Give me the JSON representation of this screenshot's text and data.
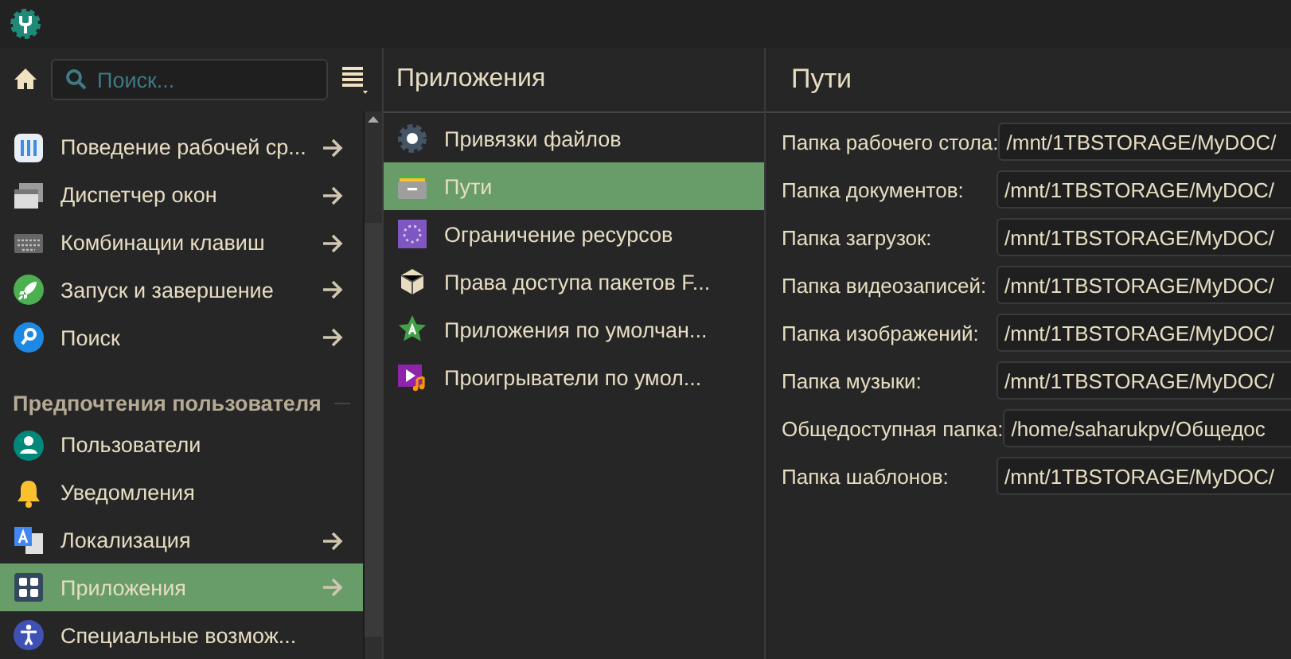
{
  "search": {
    "placeholder": "Поиск..."
  },
  "sidebar": {
    "groups": [
      {
        "items": [
          {
            "label": "Поведение рабочей ср...",
            "has_submenu": true,
            "selected": false
          },
          {
            "label": "Диспетчер окон",
            "has_submenu": true,
            "selected": false
          },
          {
            "label": "Комбинации клавиш",
            "has_submenu": true,
            "selected": false
          },
          {
            "label": "Запуск и завершение",
            "has_submenu": true,
            "selected": false
          },
          {
            "label": "Поиск",
            "has_submenu": true,
            "selected": false
          }
        ]
      },
      {
        "title": "Предпочтения пользователя",
        "items": [
          {
            "label": "Пользователи",
            "has_submenu": false,
            "selected": false
          },
          {
            "label": "Уведомления",
            "has_submenu": false,
            "selected": false
          },
          {
            "label": "Локализация",
            "has_submenu": true,
            "selected": false
          },
          {
            "label": "Приложения",
            "has_submenu": true,
            "selected": true
          },
          {
            "label": "Специальные возмож...",
            "has_submenu": false,
            "selected": false
          }
        ]
      }
    ]
  },
  "middle": {
    "title": "Приложения",
    "items": [
      {
        "label": "Привязки файлов",
        "selected": false
      },
      {
        "label": "Пути",
        "selected": true
      },
      {
        "label": "Ограничение ресурсов",
        "selected": false
      },
      {
        "label": "Права доступа пакетов F...",
        "selected": false
      },
      {
        "label": "Приложения по умолчан...",
        "selected": false
      },
      {
        "label": "Проигрыватели по умол...",
        "selected": false
      }
    ]
  },
  "content": {
    "title": "Пути",
    "fields": [
      {
        "label": "Папка рабочего стола:",
        "value": "/mnt/1TBSTORAGE/MyDOC/"
      },
      {
        "label": "Папка документов:",
        "value": "/mnt/1TBSTORAGE/MyDOC/"
      },
      {
        "label": "Папка загрузок:",
        "value": "/mnt/1TBSTORAGE/MyDOC/"
      },
      {
        "label": "Папка видеозаписей:",
        "value": "/mnt/1TBSTORAGE/MyDOC/"
      },
      {
        "label": "Папка изображений:",
        "value": "/mnt/1TBSTORAGE/MyDOC/"
      },
      {
        "label": "Папка музыки:",
        "value": "/mnt/1TBSTORAGE/MyDOC/"
      },
      {
        "label": "Общедоступная папка:",
        "value": "/home/saharukpv/Общедос"
      },
      {
        "label": "Папка шаблонов:",
        "value": "/mnt/1TBSTORAGE/MyDOC/"
      }
    ]
  }
}
